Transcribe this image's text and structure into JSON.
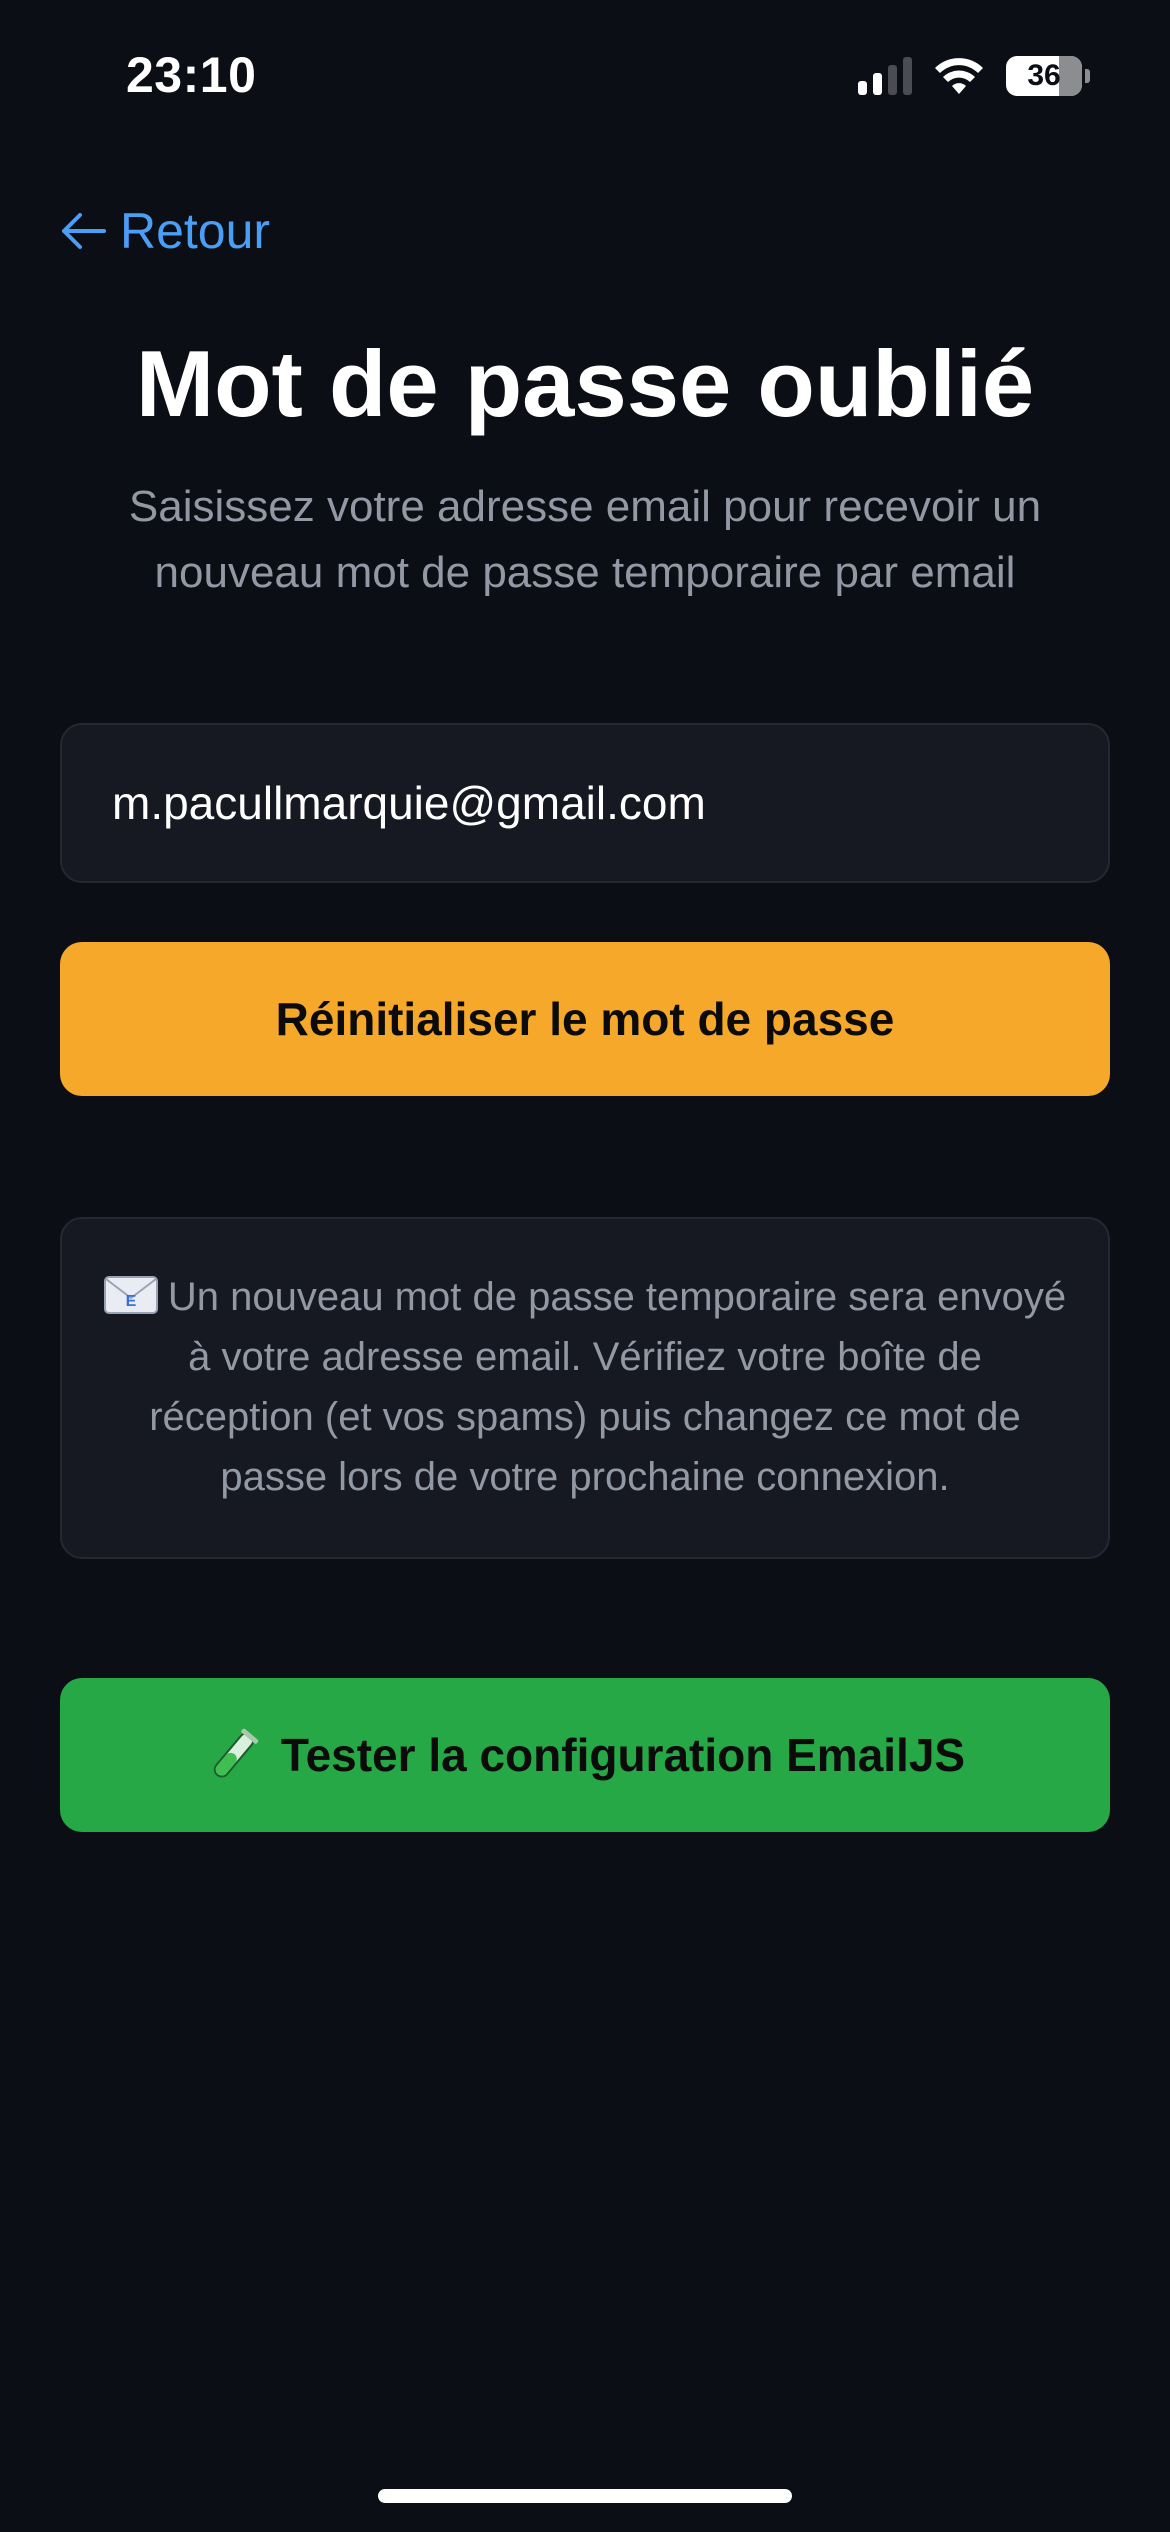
{
  "status_bar": {
    "time": "23:10",
    "battery_level": "36",
    "signal_bars_active": 2,
    "signal_bars_total": 4
  },
  "nav": {
    "back_label": "Retour"
  },
  "header": {
    "title": "Mot de passe oublié",
    "subtitle": "Saisissez votre adresse email pour recevoir un nouveau mot de passe temporaire par email"
  },
  "form": {
    "email_value": "m.pacullmarquie@gmail.com",
    "reset_button_label": "Réinitialiser le mot de passe"
  },
  "info": {
    "icon": "envelope-icon",
    "text": "Un nouveau mot de passe temporaire sera envoyé à votre adresse email. Vérifiez votre boîte de réception (et vos spams) puis changez ce mot de passe lors de votre prochaine connexion."
  },
  "test": {
    "icon": "test-tube-icon",
    "button_label": "Tester la configuration EmailJS"
  },
  "colors": {
    "background": "#0c0e15",
    "accent_link": "#4b9ef5",
    "primary_button": "#f5a829",
    "success_button": "#27a846",
    "muted_text": "#9298a4",
    "card_background": "#161921"
  }
}
